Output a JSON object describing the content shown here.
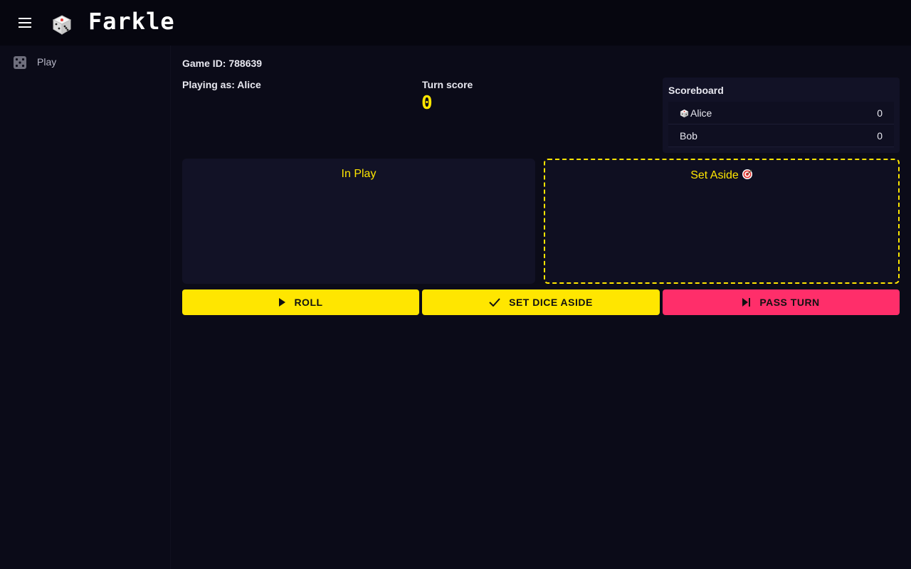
{
  "app": {
    "title": "Farkle",
    "logo_icon": "die-icon",
    "menu_icon": "hamburger-menu-icon"
  },
  "sidebar": {
    "items": [
      {
        "label": "Play",
        "icon": "dice-icon"
      }
    ]
  },
  "game": {
    "game_id_text": "Game ID: 788639",
    "playing_as_text": "Playing as: Alice",
    "turn_score_label": "Turn score",
    "turn_score_value": "0"
  },
  "scoreboard": {
    "title": "Scoreboard",
    "players": [
      {
        "name": "Alice",
        "score": "0",
        "current_turn_icon": "die-icon"
      },
      {
        "name": "Bob",
        "score": "0"
      }
    ]
  },
  "panels": {
    "in_play_title": "In Play",
    "set_aside_title": "Set Aside",
    "set_aside_icon": "target-icon"
  },
  "actions": {
    "roll_label": "ROLL",
    "set_aside_label": "SET DICE ASIDE",
    "pass_label": "PASS TURN"
  },
  "colors": {
    "accent_yellow": "#ffe600",
    "accent_pink": "#ff2e6a",
    "background": "#0b0b18",
    "appbar": "#06060f"
  }
}
